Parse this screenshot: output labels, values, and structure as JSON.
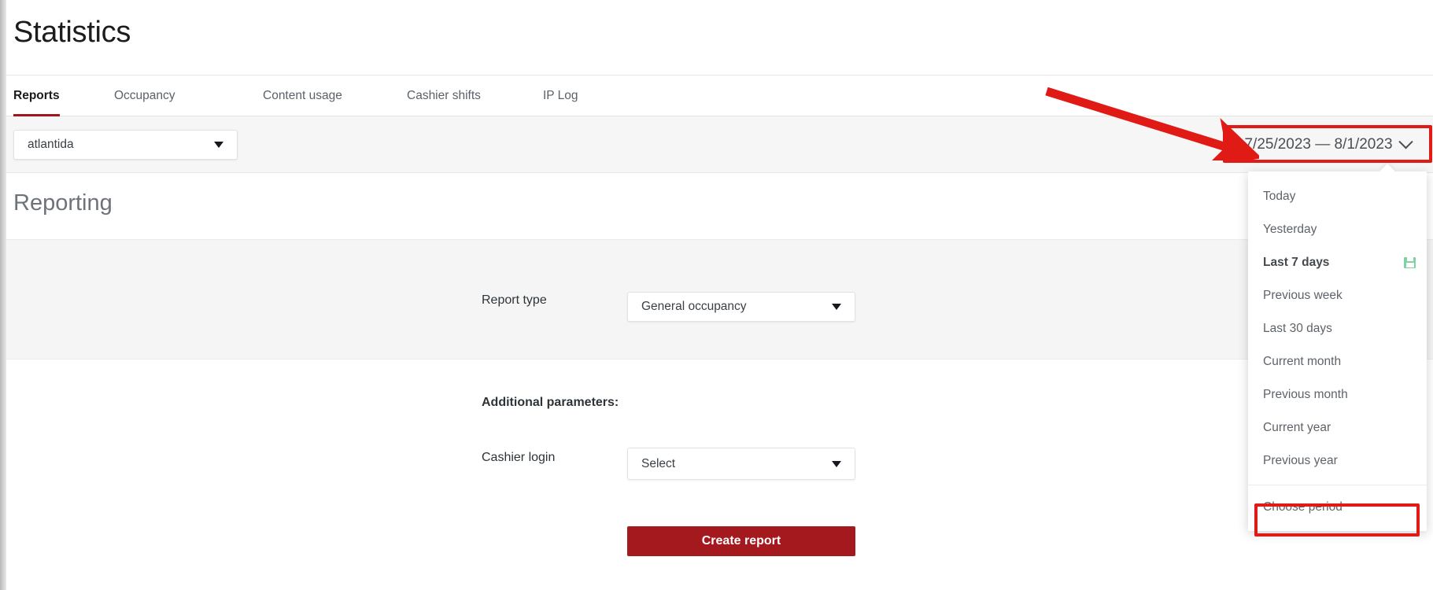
{
  "page": {
    "title": "Statistics",
    "section_title": "Reporting"
  },
  "tabs": [
    {
      "label": "Reports",
      "active": true
    },
    {
      "label": "Occupancy",
      "active": false
    },
    {
      "label": "Content usage",
      "active": false
    },
    {
      "label": "Cashier shifts",
      "active": false
    },
    {
      "label": "IP Log",
      "active": false
    }
  ],
  "filter_bar": {
    "org_select": {
      "value": "atlantida",
      "caret_icon": "chevron-down-icon"
    },
    "date_range": {
      "value": "7/25/2023 — 8/1/2023",
      "chevron_icon": "chevron-down-icon"
    }
  },
  "date_dropdown": {
    "items": [
      {
        "label": "Today",
        "selected": false,
        "icon": null
      },
      {
        "label": "Yesterday",
        "selected": false,
        "icon": null
      },
      {
        "label": "Last 7 days",
        "selected": true,
        "icon": "save-icon"
      },
      {
        "label": "Previous week",
        "selected": false,
        "icon": null
      },
      {
        "label": "Last 30 days",
        "selected": false,
        "icon": null
      },
      {
        "label": "Current month",
        "selected": false,
        "icon": null
      },
      {
        "label": "Previous month",
        "selected": false,
        "icon": null
      },
      {
        "label": "Current year",
        "selected": false,
        "icon": null
      },
      {
        "label": "Previous year",
        "selected": false,
        "icon": null
      }
    ],
    "footer_item": {
      "label": "Choose period"
    }
  },
  "form": {
    "report_type_label": "Report type",
    "report_type_value": "General occupancy",
    "additional_parameters_label": "Additional parameters:",
    "cashier_login_label": "Cashier login",
    "cashier_login_value": "Select",
    "create_report_label": "Create report"
  },
  "annotations": {
    "arrow_color": "#e01b16",
    "box_color": "#e01b16"
  },
  "colors": {
    "brand_red": "#a4191e",
    "tab_underline": "#a0151b",
    "band_gray": "#f5f5f5",
    "save_icon_green": "#7fd3a1"
  }
}
